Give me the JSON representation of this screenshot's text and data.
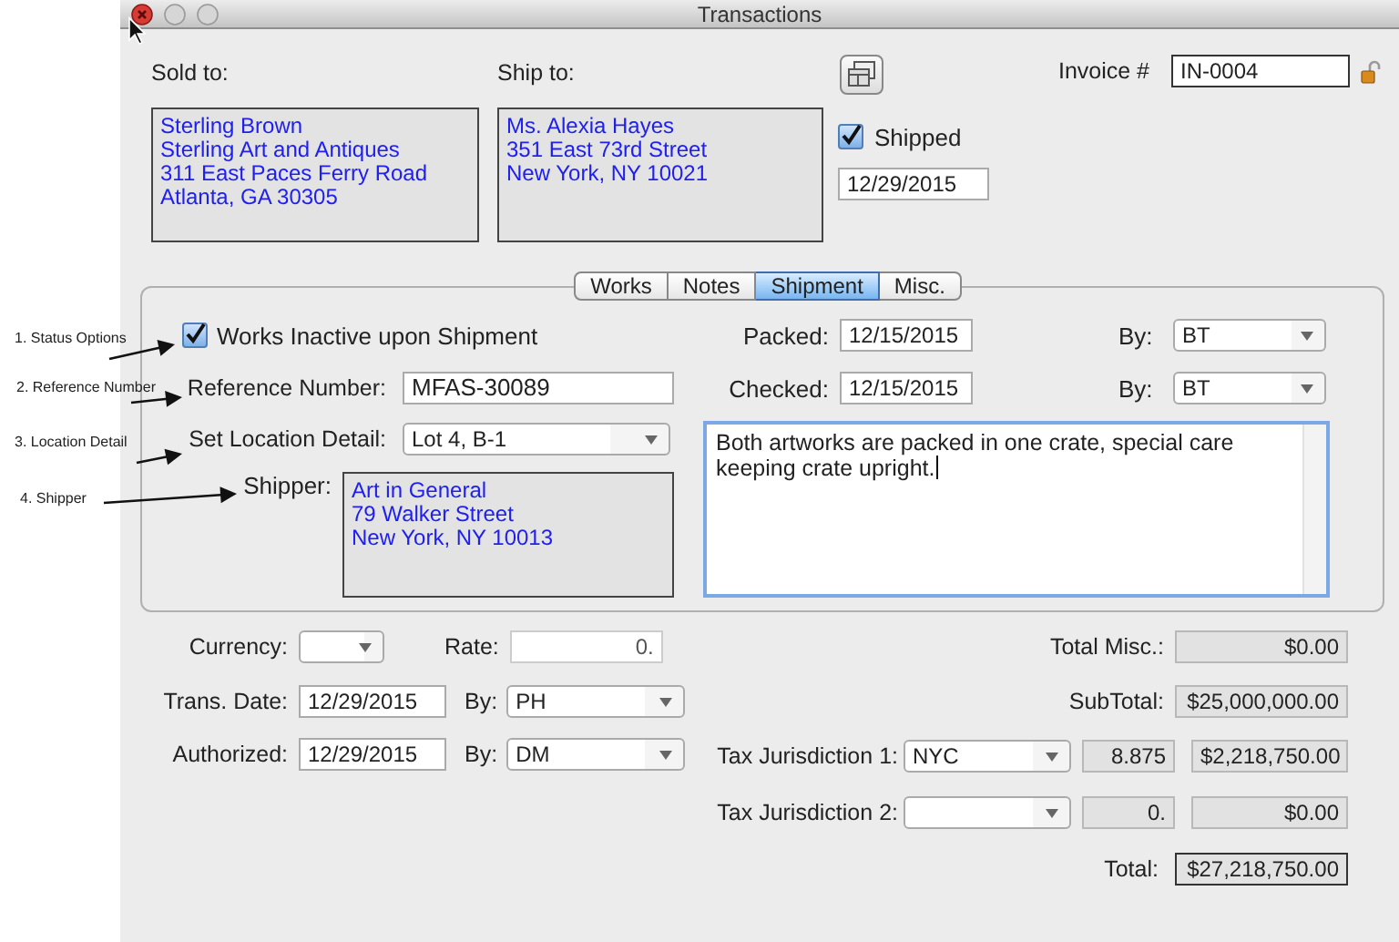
{
  "window": {
    "title": "Transactions"
  },
  "sold_to": {
    "label": "Sold to:",
    "lines": [
      "Sterling Brown",
      "Sterling Art and Antiques",
      "311 East Paces Ferry Road",
      "Atlanta, GA 30305"
    ]
  },
  "ship_to": {
    "label": "Ship to:",
    "lines": [
      "Ms. Alexia Hayes",
      "351 East 73rd Street",
      "New York, NY 10021"
    ]
  },
  "shipped": {
    "label": "Shipped",
    "checked": true,
    "date": "12/29/2015"
  },
  "invoice": {
    "label": "Invoice #",
    "value": "IN-0004"
  },
  "tabs": [
    {
      "label": "Works",
      "selected": false
    },
    {
      "label": "Notes",
      "selected": false
    },
    {
      "label": "Shipment",
      "selected": true
    },
    {
      "label": "Misc.",
      "selected": false
    }
  ],
  "shipment": {
    "works_inactive": {
      "label": "Works Inactive upon Shipment",
      "checked": true
    },
    "reference": {
      "label": "Reference Number:",
      "value": "MFAS-30089"
    },
    "location": {
      "label": "Set Location Detail:",
      "value": "Lot 4, B-1"
    },
    "shipper": {
      "label": "Shipper:",
      "lines": [
        "Art in General",
        "79 Walker Street",
        "New York, NY 10013"
      ]
    },
    "packed": {
      "label": "Packed:",
      "date": "12/15/2015",
      "by_label": "By:",
      "by": "BT"
    },
    "checked": {
      "label": "Checked:",
      "date": "12/15/2015",
      "by_label": "By:",
      "by": "BT"
    },
    "notes": "Both artworks are packed in one crate, special care keeping crate upright."
  },
  "annotations": [
    {
      "text": "1. Status Options"
    },
    {
      "text": "2. Reference Number"
    },
    {
      "text": "3. Location Detail"
    },
    {
      "text": "4. Shipper"
    }
  ],
  "currency": {
    "label": "Currency:"
  },
  "rate": {
    "label": "Rate:",
    "value": "0."
  },
  "trans_date": {
    "label": "Trans. Date:",
    "date": "12/29/2015",
    "by_label": "By:",
    "by": "PH"
  },
  "authorized": {
    "label": "Authorized:",
    "date": "12/29/2015",
    "by_label": "By:",
    "by": "DM"
  },
  "total_misc": {
    "label": "Total Misc.:",
    "value": "$0.00"
  },
  "subtotal": {
    "label": "SubTotal:",
    "value": "$25,000,000.00"
  },
  "taxes": [
    {
      "label": "Tax Jurisdiction 1:",
      "jurisdiction": "NYC",
      "rate": "8.875",
      "amount": "$2,218,750.00"
    },
    {
      "label": "Tax Jurisdiction 2:",
      "rate": "0.",
      "amount": "$0.00"
    }
  ],
  "total": {
    "label": "Total:",
    "value": "$27,218,750.00"
  }
}
